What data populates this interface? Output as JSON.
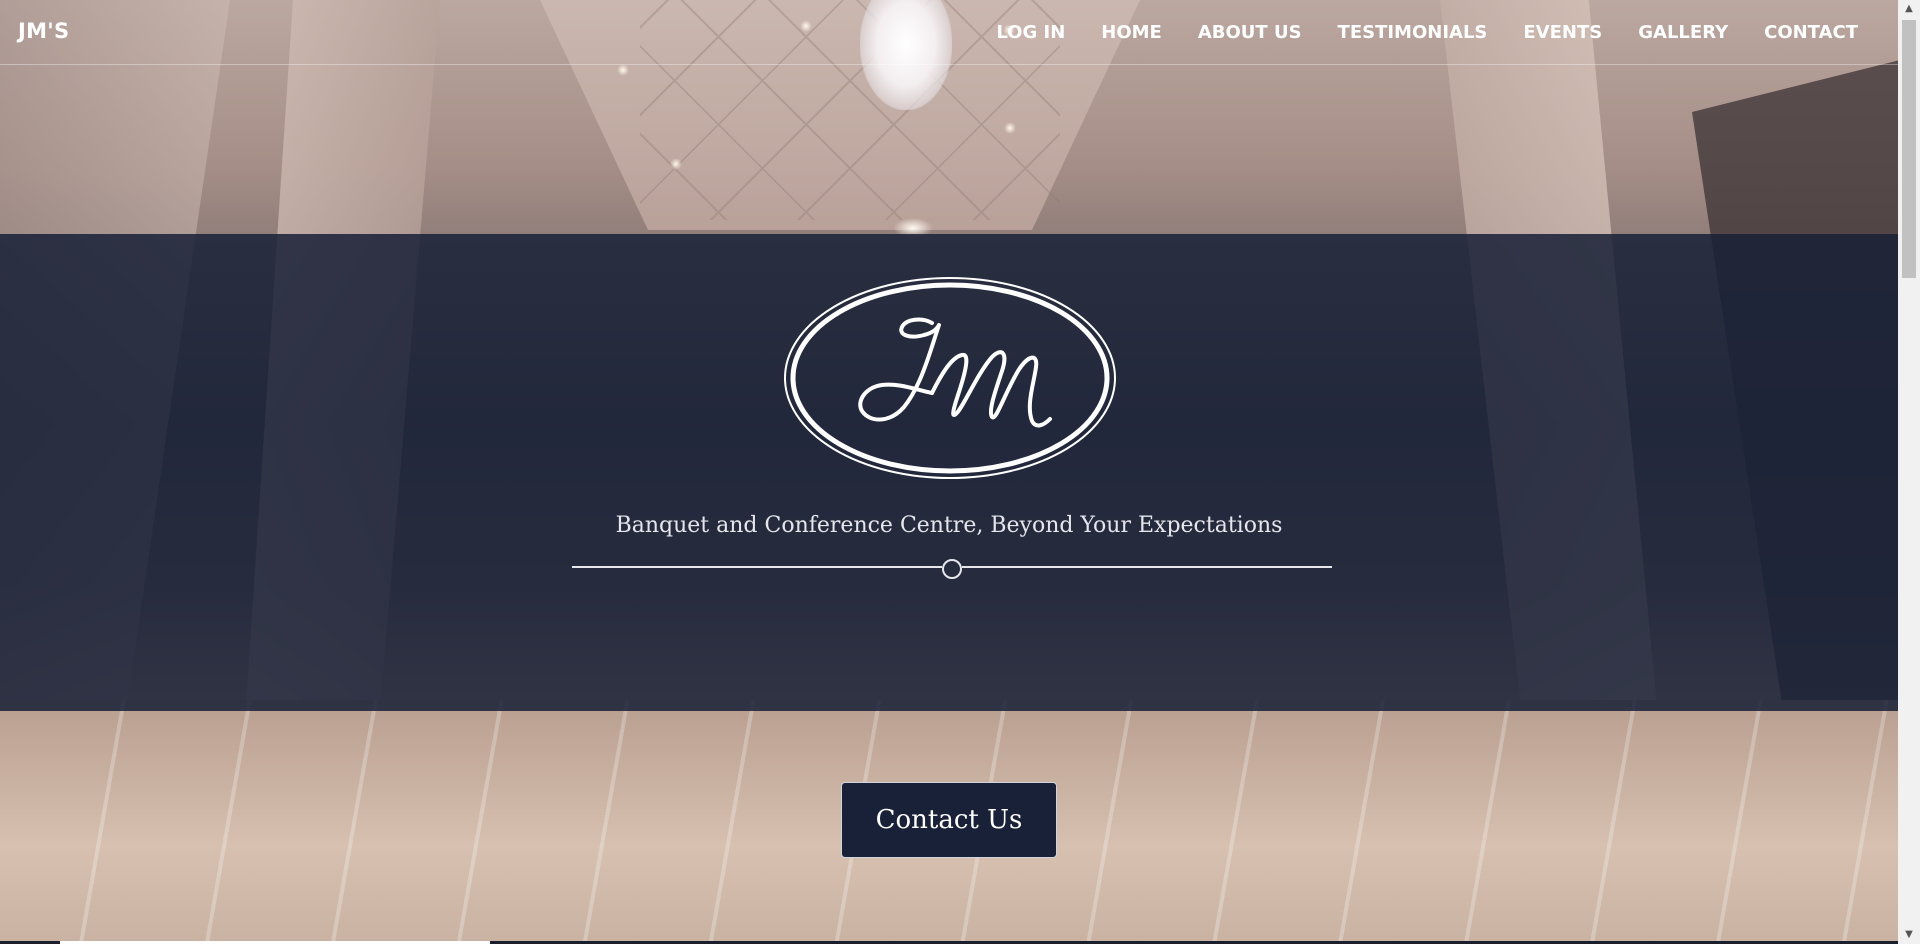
{
  "brand": "JM'S",
  "nav": {
    "items": [
      {
        "label": "LOG IN"
      },
      {
        "label": "HOME"
      },
      {
        "label": "ABOUT US"
      },
      {
        "label": "TESTIMONIALS"
      },
      {
        "label": "EVENTS"
      },
      {
        "label": "GALLERY"
      },
      {
        "label": "CONTACT"
      }
    ]
  },
  "hero": {
    "logo_text": "JM",
    "tagline": "Banquet and Conference Centre, Beyond Your Expectations",
    "cta_label": "Contact Us"
  },
  "colors": {
    "band": "#182137",
    "accent_text": "#ffffff",
    "button_bg": "#192139"
  },
  "icons": {
    "scroll_up": "scroll-up-arrow",
    "scroll_down": "scroll-down-arrow"
  }
}
